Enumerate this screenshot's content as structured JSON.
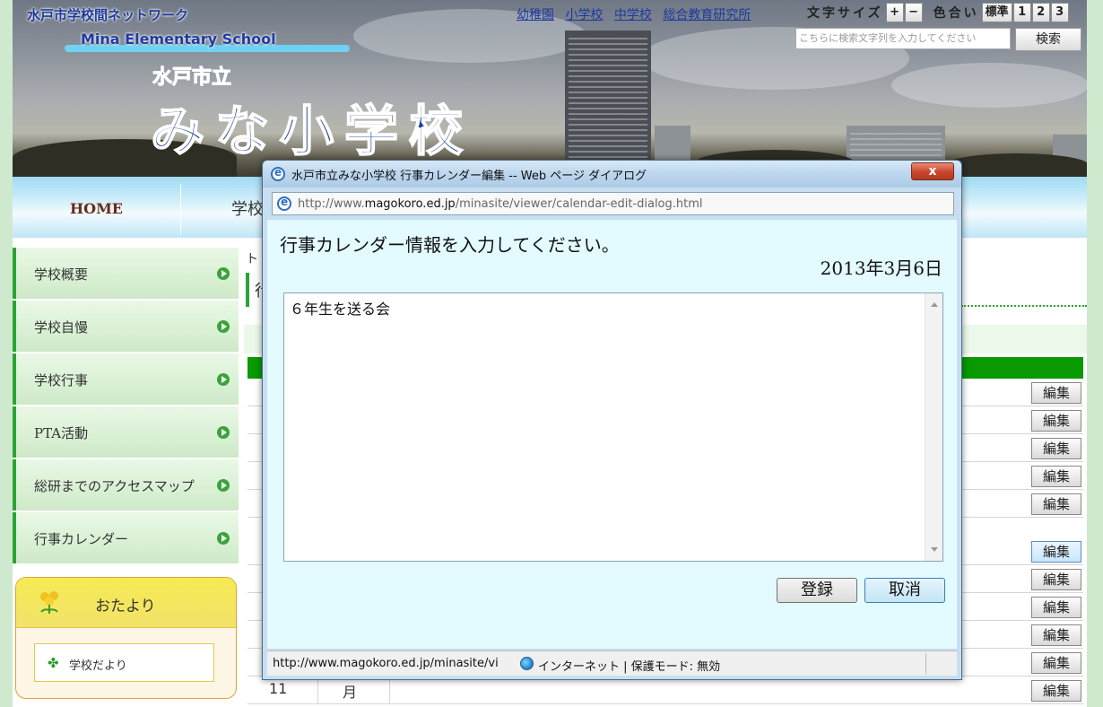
{
  "header": {
    "network_title": "水戸市学校間ネットワーク",
    "school_name_en": "Mina Elementary School",
    "school_city": "水戸市立",
    "school_name": "みな小学校"
  },
  "top_links": [
    {
      "label": "幼稚園"
    },
    {
      "label": "小学校"
    },
    {
      "label": "中学校"
    },
    {
      "label": "総合教育研究所"
    }
  ],
  "font_controls": {
    "label": "文字サイズ",
    "increase": "+",
    "decrease": "−"
  },
  "color_controls": {
    "label": "色合い",
    "standard": "標準",
    "option1": "1",
    "option2": "2",
    "option3": "3"
  },
  "search": {
    "placeholder": "こちらに検索文字列を入力してください",
    "button_label": "検索"
  },
  "nav": {
    "home": "HOME",
    "school": "学校"
  },
  "sidebar": {
    "items": [
      {
        "label": "学校概要"
      },
      {
        "label": "学校自慢"
      },
      {
        "label": "学校行事"
      },
      {
        "label": "PTA活動"
      },
      {
        "label": "総研までのアクセスマップ"
      },
      {
        "label": "行事カレンダー"
      }
    ],
    "otayori_title": "おたより",
    "newsletter_label": "学校だより"
  },
  "content": {
    "breadcrumb": "ト",
    "title_char": "行",
    "edit_label": "編集",
    "last_row": {
      "num": "11",
      "day": "月"
    }
  },
  "dialog": {
    "title": "水戸市立みな小学校 行事カレンダー編集 -- Web ページ ダイアログ",
    "close_label": "x",
    "address_prefix": "http://www.",
    "address_host": "magokoro.ed.jp",
    "address_path": "/minasite/viewer/calendar-edit-dialog.html",
    "prompt": "行事カレンダー情報を入力してください。",
    "date": "2013年3月6日",
    "textarea_value": "６年生を送る会",
    "submit_label": "登録",
    "cancel_label": "取消",
    "status_url": "http://www.magokoro.ed.jp/minasite/vi",
    "status_zone": "インターネット | 保護モード: 無効"
  },
  "colors": {
    "accent_green": "#089a00",
    "link_blue": "#1d3aa0",
    "dialog_body": "#e3faff"
  }
}
